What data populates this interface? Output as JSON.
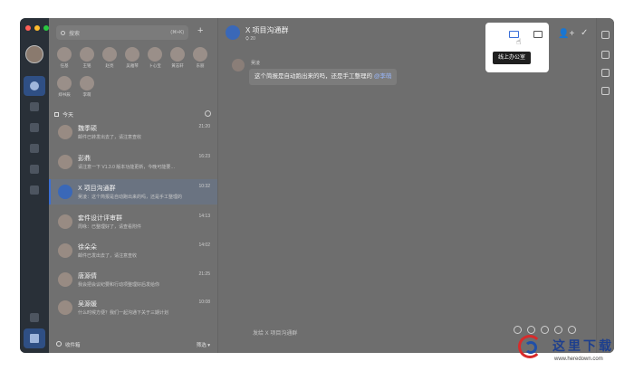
{
  "window": {
    "traffic_colors": [
      "#ff5f57",
      "#febc2e",
      "#28c840"
    ]
  },
  "search": {
    "placeholder": "搜索",
    "shortcut": "(⌘+K)"
  },
  "add_label": "+",
  "contacts": [
    {
      "name": "任基"
    },
    {
      "name": "王铭"
    },
    {
      "name": "赵亮"
    },
    {
      "name": "吴雅琴"
    },
    {
      "name": "卜心宝"
    },
    {
      "name": "黄志轩"
    },
    {
      "name": "东丽"
    },
    {
      "name": "郑书辰"
    },
    {
      "name": "李萌"
    }
  ],
  "section_today": "今天",
  "conversations": [
    {
      "name": "魏季硕",
      "preview": "邮件已转发出去了，请注意查收",
      "time": "21:20",
      "active": false
    },
    {
      "name": "彭鼎",
      "preview": "请注意一下 V1.3.0 版本功能更新，今晚可能要…",
      "time": "16:23",
      "active": false
    },
    {
      "name": "X 项目沟通群",
      "preview": "吴凌：这个简报是自动跑出来的吗，还是手工整理的",
      "time": "10:32",
      "active": true
    },
    {
      "name": "套件设计评审群",
      "preview": "周咏：已整理好了，请查看附件",
      "time": "14:13",
      "active": false
    },
    {
      "name": "徐朵朵",
      "preview": "邮件已发出去了，请注意查收",
      "time": "14:02",
      "active": false
    },
    {
      "name": "唐源倩",
      "preview": "我会把会议纪要和行动项整理好后发给你",
      "time": "21:25",
      "active": false
    },
    {
      "name": "吴源媛",
      "preview": "什么时候方便？我们一起沟通下关于三期计划",
      "time": "10:08",
      "active": false
    }
  ],
  "footer": {
    "label": "收件箱",
    "filter": "筛选 ▾"
  },
  "chat": {
    "title": "X 项目沟通群",
    "subtitle": "⛭ 20",
    "message": {
      "sender": "吴凌",
      "text": "这个简报是自动跑出来的吗，还是手工整理的",
      "mention": "@李萌"
    },
    "tooltip": "线上办公室",
    "add_member_icon": "👤+",
    "done_icon": "✓",
    "input_placeholder": "发给 X 项目沟通群"
  },
  "watermark": {
    "text": "这里下载",
    "url": "www.heredown.com"
  }
}
